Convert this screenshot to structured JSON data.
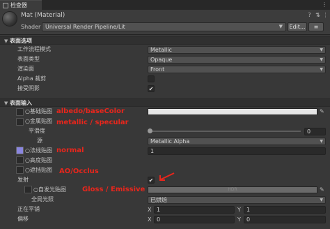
{
  "tab": {
    "label": "检查器",
    "menu_icon": "more-icon"
  },
  "header": {
    "title": "Mat (Material)",
    "shader_label": "Shader",
    "shader_value": "Universal Render Pipeline/Lit",
    "edit_button": "Edit...",
    "menu_button": "≡"
  },
  "surface_options": {
    "title": "表面选项",
    "rows": [
      {
        "label": "工作流程模式",
        "value": "Metallic"
      },
      {
        "label": "表面类型",
        "value": "Opaque"
      },
      {
        "label": "渲染面",
        "value": "Front"
      },
      {
        "label": "Alpha 裁剪",
        "checked": false
      },
      {
        "label": "接受阴影",
        "checked": true
      }
    ]
  },
  "surface_inputs": {
    "title": "表面输入",
    "base_map": "○基础贴图",
    "metallic_map": "○金属贴图",
    "smoothness": "平滑度",
    "smoothness_value": "0",
    "source": "源",
    "source_value": "Metallic Alpha",
    "normal_map": "○法线贴图",
    "normal_value": "1",
    "height_map": "○高度贴图",
    "occlusion_map": "○遮挡贴图",
    "emission": "发射",
    "emission_checked": true,
    "emission_map": "○自发光贴图",
    "emission_hdr": "HDR",
    "global_illumination": "全局光照",
    "gi_value": "已烘焙",
    "tiling": "正在平铺",
    "offset": "偏移",
    "tiling_x": "1",
    "tiling_y": "1",
    "offset_x": "0",
    "offset_y": "0",
    "axis_x": "X",
    "axis_y": "Y"
  },
  "annotations": {
    "albedo": "albedo/baseColor",
    "metallic": "metallic / specular",
    "normal": "normal",
    "ao": "AO/Occlus",
    "gloss": "Gloss / Emissive"
  },
  "colors": {
    "annotation": "#e8261c",
    "base_color": "#e6e6e6",
    "emission_color": "#6a6a6a",
    "normal_swatch": "#8a86e0"
  }
}
